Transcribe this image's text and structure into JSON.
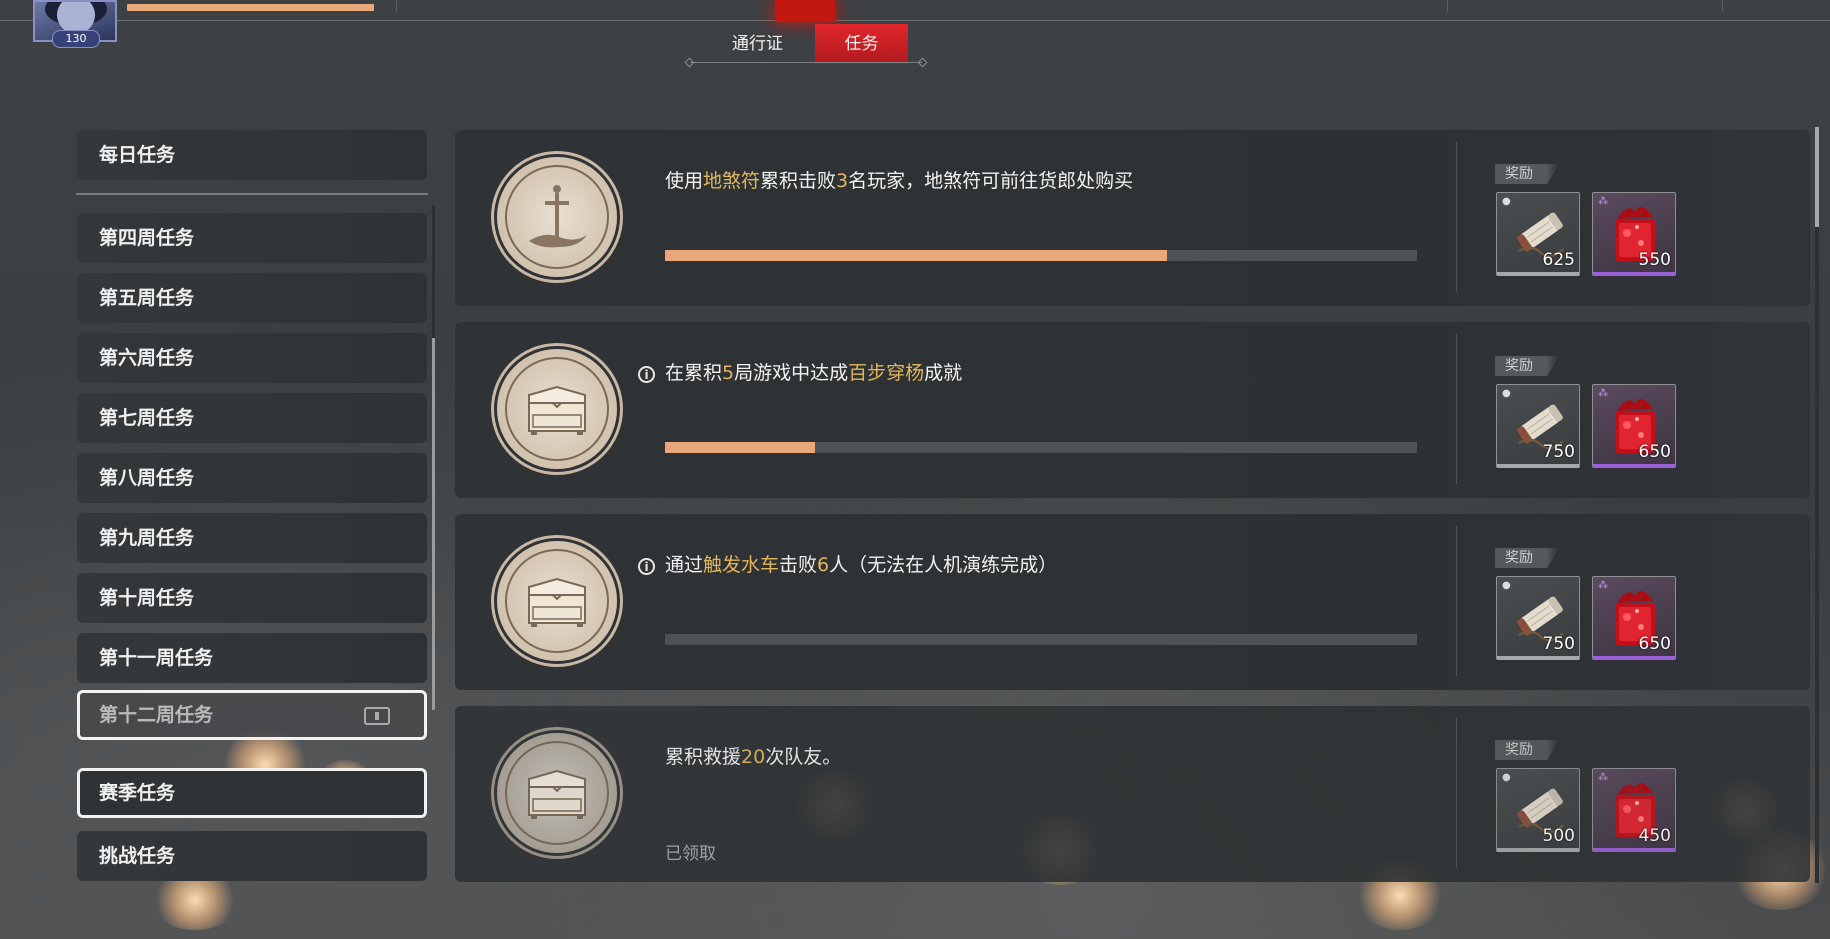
{
  "header": {
    "level": "130"
  },
  "tabs": [
    {
      "label": "通行证",
      "active": false
    },
    {
      "label": "任务",
      "active": true
    }
  ],
  "sidebar": {
    "daily": "每日任务",
    "weeks": [
      "第四周任务",
      "第五周任务",
      "第六周任务",
      "第七周任务",
      "第八周任务",
      "第九周任务",
      "第十周任务",
      "第十一周任务"
    ],
    "selected_week": "第十二周任务",
    "season": "赛季任务",
    "challenge": "挑战任务"
  },
  "tasks": [
    {
      "text_parts": [
        "使用",
        "地煞符",
        "累积击败",
        "3",
        "名玩家，地煞符可前往货郎处购买"
      ],
      "progress_text": "2/3",
      "progress": 0.667,
      "has_info": false,
      "icon": "sword-icon",
      "reward_label": "奖励",
      "rewards": [
        {
          "type": "scroll",
          "count": "625"
        },
        {
          "type": "gem",
          "count": "550"
        }
      ]
    },
    {
      "text_parts": [
        "在累积",
        "5",
        "局游戏中达成",
        "百步穿杨",
        "成就"
      ],
      "progress_text": "1/5",
      "progress": 0.2,
      "has_info": true,
      "icon": "chest-icon",
      "reward_label": "奖励",
      "rewards": [
        {
          "type": "scroll",
          "count": "750"
        },
        {
          "type": "gem",
          "count": "650"
        }
      ]
    },
    {
      "text_parts": [
        "通过",
        "触发水车",
        "击败",
        "6",
        "人（无法在人机演练完成）"
      ],
      "progress_text": "0/6",
      "progress": 0,
      "has_info": true,
      "icon": "chest-icon",
      "reward_label": "奖励",
      "rewards": [
        {
          "type": "scroll",
          "count": "750"
        },
        {
          "type": "gem",
          "count": "650"
        }
      ]
    },
    {
      "text_parts": [
        "累积救援",
        "20",
        "次队友。"
      ],
      "status_text": "已领取",
      "has_info": false,
      "icon": "chest-icon",
      "reward_label": "奖励",
      "rewards": [
        {
          "type": "scroll",
          "count": "500"
        },
        {
          "type": "gem",
          "count": "450"
        }
      ]
    }
  ]
}
